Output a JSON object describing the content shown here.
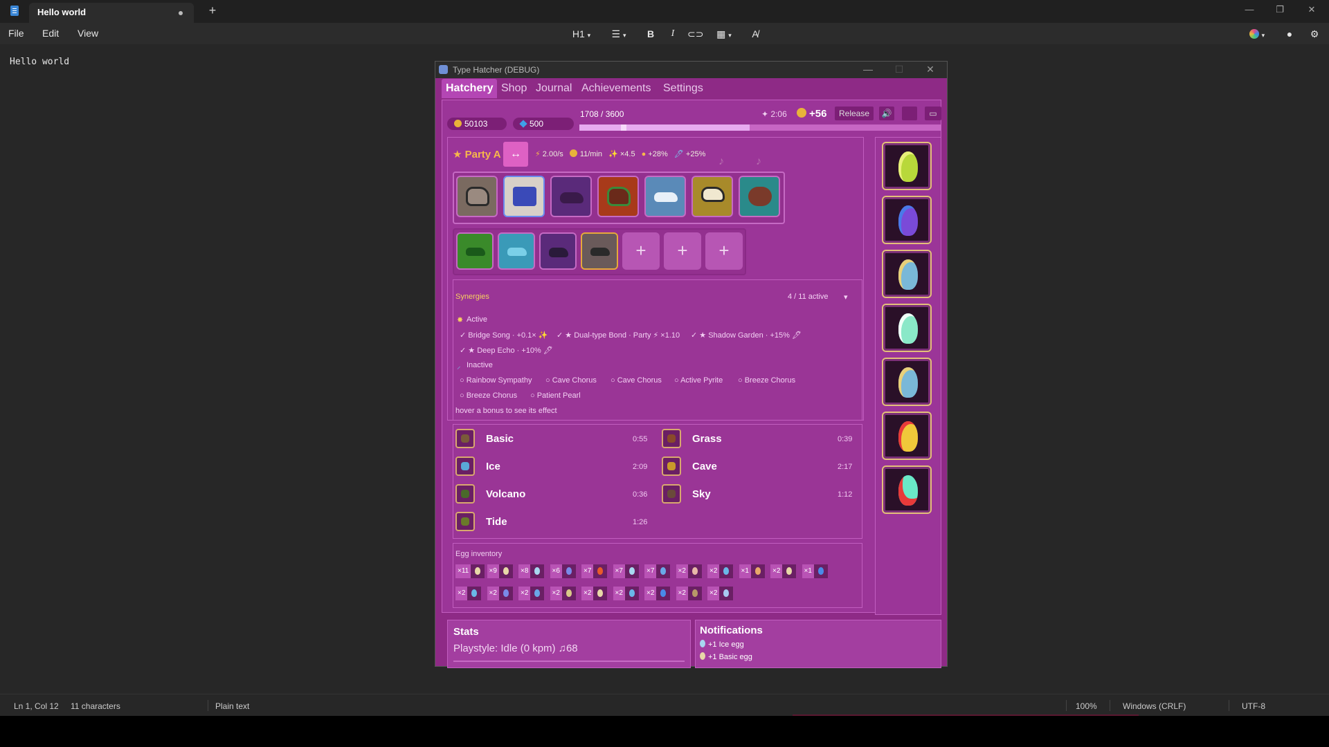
{
  "notepad": {
    "tab_title": "Hello world",
    "new_tab": "+",
    "menus": [
      "File",
      "Edit",
      "View"
    ],
    "heading_tool": "H1",
    "document_text": "Hello world",
    "status": {
      "position": "Ln 1, Col 12",
      "chars": "11 characters",
      "format": "Plain text",
      "zoom": "100%",
      "line_endings": "Windows (CRLF)",
      "encoding": "UTF-8"
    }
  },
  "game": {
    "window_title": "Type Hatcher (DEBUG)",
    "tabs": [
      "Hatchery",
      "Shop",
      "Journal",
      "Achievements",
      "Settings"
    ],
    "coins": "50103",
    "gems": "500",
    "xp_text": "1708 / 3600",
    "xp_fraction": 0.47,
    "timer": "✦ 2:06",
    "coin_gain": "+56",
    "release_label": "Release",
    "party": {
      "name": "★ Party A",
      "swap": "↔",
      "stats": [
        "2.00/s",
        "11/min",
        "×4.5",
        "+28%",
        "+25%"
      ]
    },
    "add_slot": "+",
    "synergies": {
      "title": "Synergies",
      "count": "4 / 11 active",
      "toggle": "▾",
      "active_label": "Active",
      "active": [
        "✓ Bridge Song · +0.1× ✨",
        "✓ ★ Dual-type Bond · Party ⚡ ×1.10",
        "✓ ★ Shadow Garden · +15% 🖊",
        "✓ ★ Deep Echo · +10% 🖊"
      ],
      "inactive_label": "Inactive",
      "inactive": [
        "○ Rainbow Sympathy",
        "○ Cave Chorus",
        "○ Cave Chorus",
        "○ Active Pyrite",
        "○ Breeze Chorus",
        "○ Breeze Chorus",
        "○ Patient Pearl"
      ],
      "hint": "hover a bonus to see its effect"
    },
    "egg_types": [
      {
        "name": "Basic",
        "time": "0:55",
        "color": "#7a5a3a"
      },
      {
        "name": "Grass",
        "time": "0:39",
        "color": "#8a4a2a"
      },
      {
        "name": "Ice",
        "time": "2:09",
        "color": "#5aa8d8"
      },
      {
        "name": "Cave",
        "time": "2:17",
        "color": "#c99a2a"
      },
      {
        "name": "Volcano",
        "time": "0:36",
        "color": "#4a6a2a"
      },
      {
        "name": "Sky",
        "time": "1:12",
        "color": "#6a4a3a"
      },
      {
        "name": "Tide",
        "time": "1:26",
        "color": "#6a7a2a"
      }
    ],
    "inventory_title": "Egg inventory",
    "inventory": [
      {
        "n": "×11",
        "c": "#e8d8a8"
      },
      {
        "n": "×9",
        "c": "#e8d8a8"
      },
      {
        "n": "×8",
        "c": "#a8d8f0"
      },
      {
        "n": "×6",
        "c": "#7a8ae8"
      },
      {
        "n": "×7",
        "c": "#e85a2a"
      },
      {
        "n": "×7",
        "c": "#a8d8f0"
      },
      {
        "n": "×7",
        "c": "#6aa8e8"
      },
      {
        "n": "×2",
        "c": "#e8b8a8"
      },
      {
        "n": "×2",
        "c": "#6ab8e8"
      },
      {
        "n": "×1",
        "c": "#e8a86a"
      },
      {
        "n": "×2",
        "c": "#e8d8a8"
      },
      {
        "n": "×1",
        "c": "#4a8ae8"
      },
      {
        "n": "×2",
        "c": "#6ab8e8"
      },
      {
        "n": "×2",
        "c": "#7a8ae8"
      },
      {
        "n": "×2",
        "c": "#6aa8e8"
      },
      {
        "n": "×2",
        "c": "#d8c888"
      },
      {
        "n": "×2",
        "c": "#e8d8a8"
      },
      {
        "n": "×2",
        "c": "#6ab8e8"
      },
      {
        "n": "×2",
        "c": "#4a8ae8"
      },
      {
        "n": "×2",
        "c": "#b89868"
      },
      {
        "n": "×2",
        "c": "#a8c8f0"
      }
    ],
    "stats_title": "Stats",
    "playstyle": "Playstyle: Idle (0 kpm) ♫68",
    "notif_title": "Notifications",
    "notifications": [
      "+1 Ice egg",
      "+1 Basic egg"
    ]
  }
}
